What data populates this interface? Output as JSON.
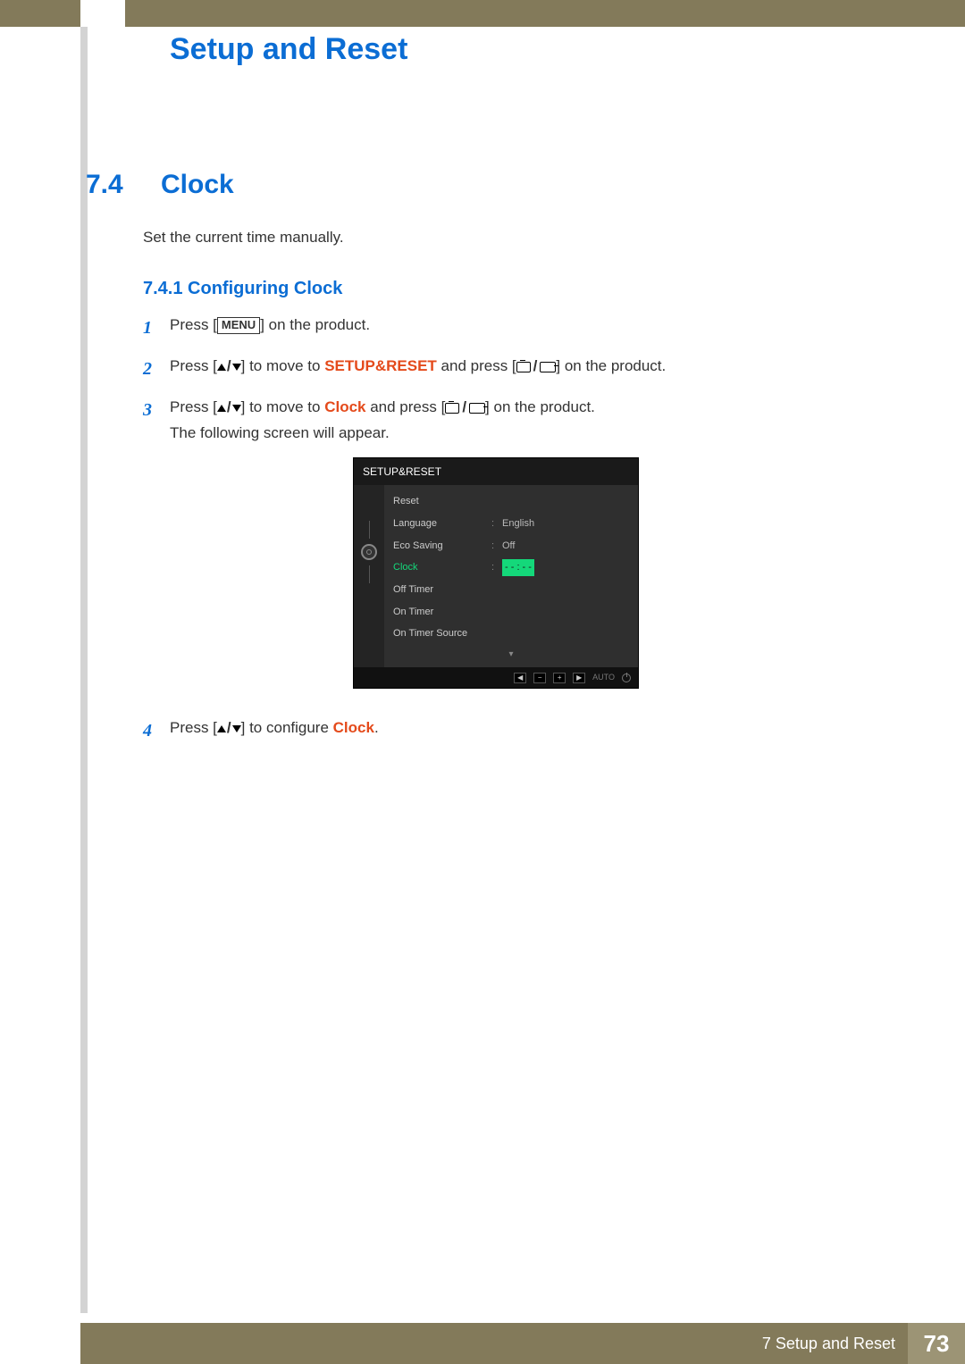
{
  "chapter_title": "Setup and Reset",
  "section": {
    "num": "7.4",
    "title": "Clock"
  },
  "intro": "Set the current time manually.",
  "subsection": "7.4.1   Configuring Clock",
  "steps": {
    "s1_a": "Press [",
    "s1_menu": "MENU",
    "s1_b": "] on the product.",
    "s2_a": "Press [",
    "s2_b": "] to move to ",
    "s2_target": "SETUP&RESET",
    "s2_c": " and press [",
    "s2_d": "] on the product.",
    "s3_a": "Press [",
    "s3_b": "] to move to ",
    "s3_target": "Clock",
    "s3_c": " and press [",
    "s3_d": "] on the product.",
    "s3_e": "The following screen will appear.",
    "s4_a": "Press [",
    "s4_b": "] to configure ",
    "s4_target": "Clock",
    "s4_c": "."
  },
  "osd": {
    "title": "SETUP&RESET",
    "rows": [
      {
        "label": "Reset",
        "val": ""
      },
      {
        "label": "Language",
        "val": "English"
      },
      {
        "label": "Eco Saving",
        "val": "Off"
      },
      {
        "label": "Clock",
        "val": "- -   :  - -",
        "sel": true
      },
      {
        "label": "Off Timer",
        "val": ""
      },
      {
        "label": "On Timer",
        "val": ""
      },
      {
        "label": "On Timer Source",
        "val": ""
      }
    ],
    "footer_auto": "AUTO"
  },
  "footer": {
    "label": "7 Setup and Reset",
    "page": "73"
  }
}
